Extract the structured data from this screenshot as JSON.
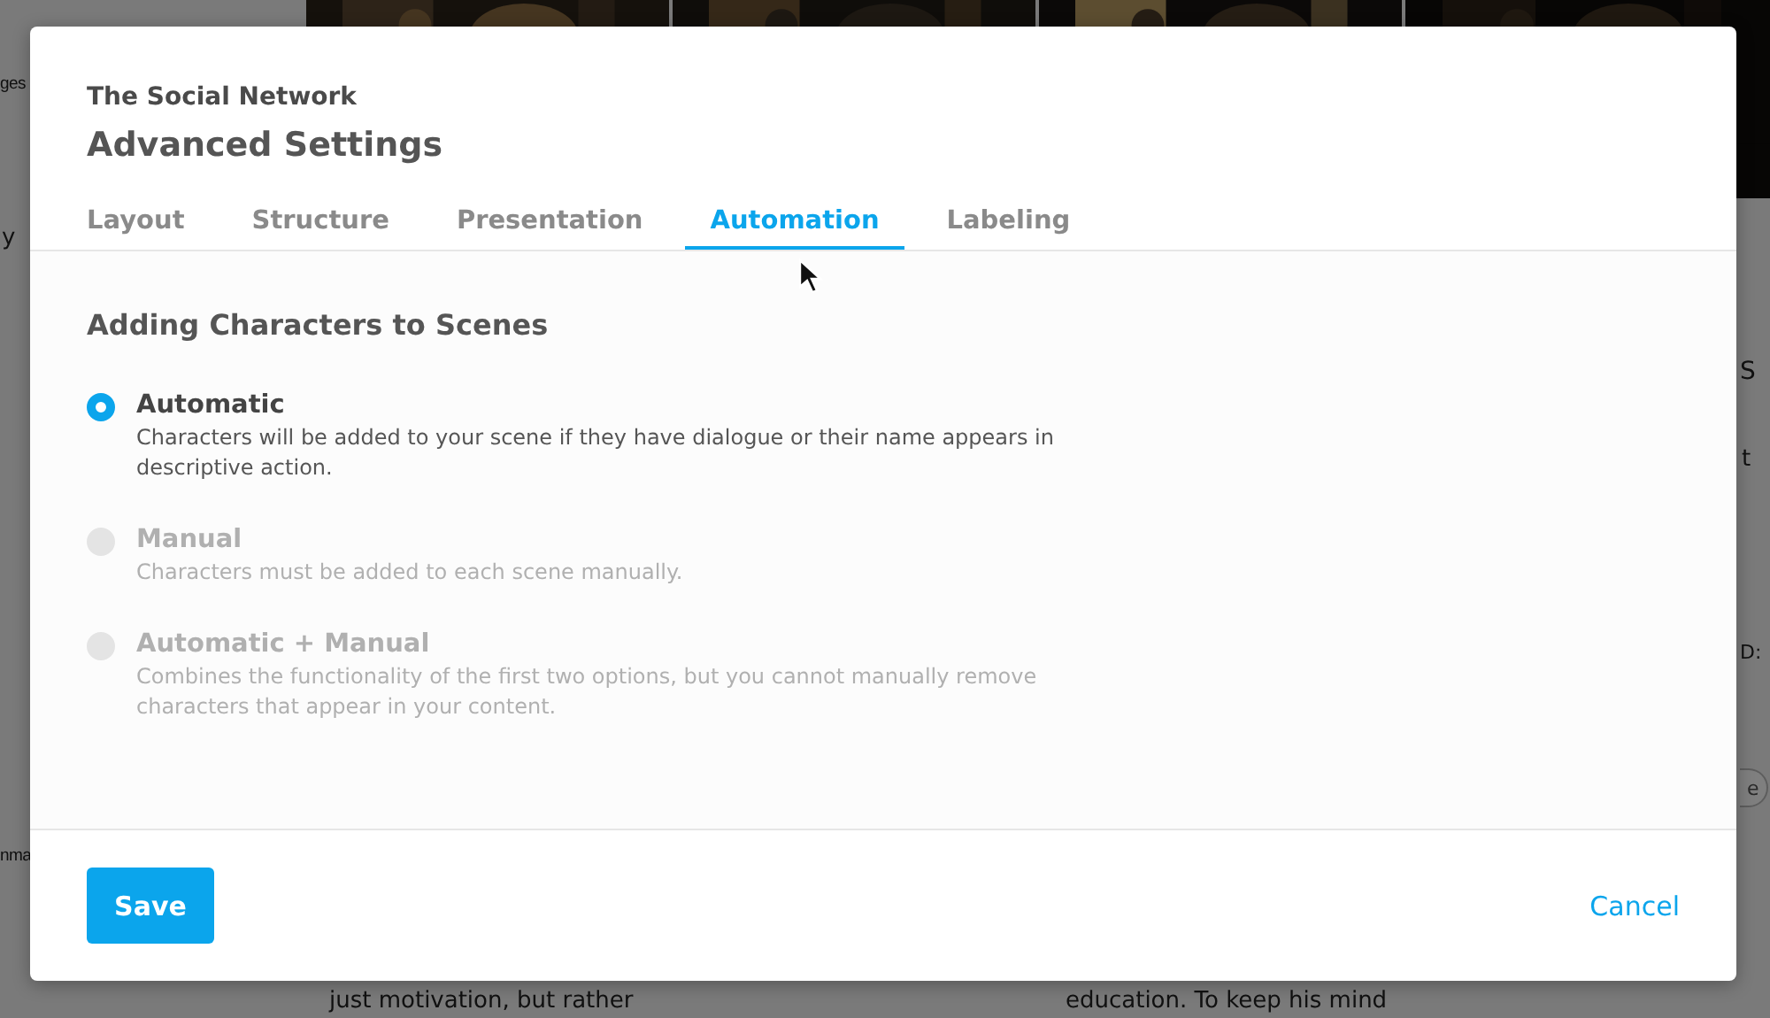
{
  "background": {
    "fragments": [
      "ges",
      "y",
      "nma",
      "S",
      "t",
      "D:",
      "just motivation, but rather",
      "education. To keep his mind"
    ],
    "button": "e"
  },
  "dialog": {
    "subtitle": "The Social Network",
    "title": "Advanced Settings",
    "tabs": [
      {
        "label": "Layout",
        "selected": false
      },
      {
        "label": "Structure",
        "selected": false
      },
      {
        "label": "Presentation",
        "selected": false
      },
      {
        "label": "Automation",
        "selected": true
      },
      {
        "label": "Labeling",
        "selected": false
      }
    ],
    "section_title": "Adding Characters to Scenes",
    "options": [
      {
        "label": "Automatic",
        "description": "Characters will be added to your scene if they have dialogue or their name appears in descriptive action.",
        "selected": true,
        "disabled": false
      },
      {
        "label": "Manual",
        "description": "Characters must be added to each scene manually.",
        "selected": false,
        "disabled": true
      },
      {
        "label": "Automatic + Manual",
        "description": "Combines the functionality of the first two options, but you cannot manually remove characters that appear in your content.",
        "selected": false,
        "disabled": true
      }
    ],
    "save": "Save",
    "cancel": "Cancel"
  }
}
